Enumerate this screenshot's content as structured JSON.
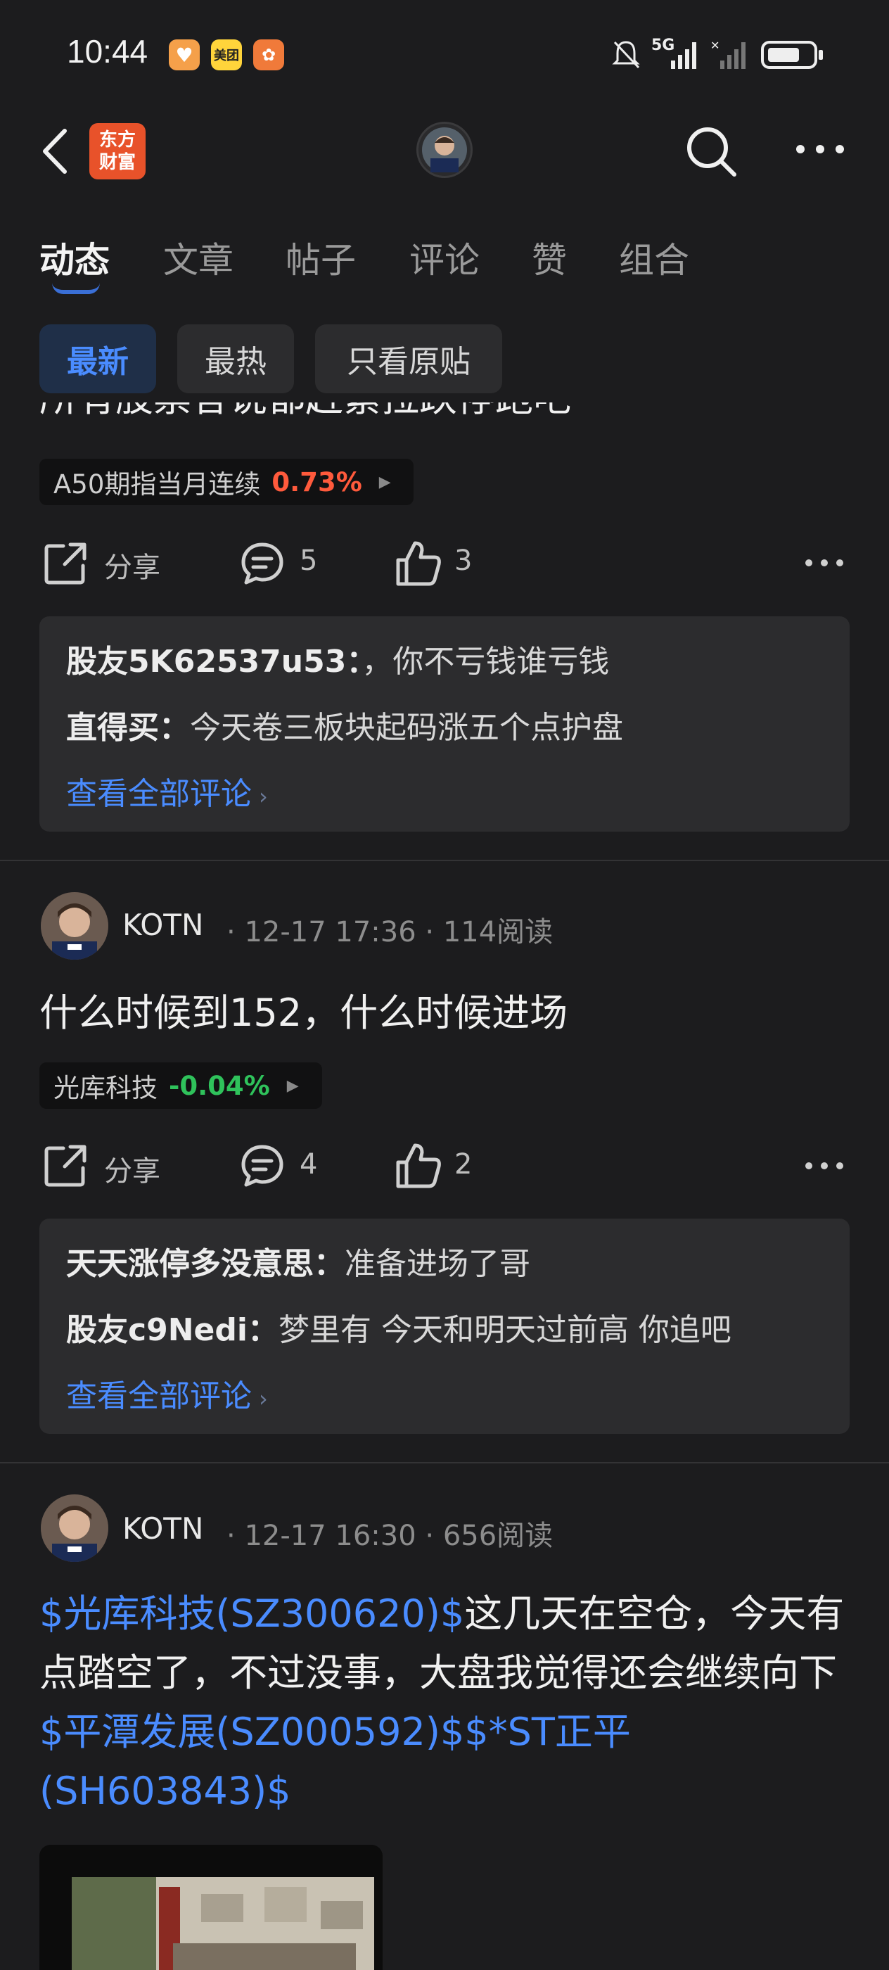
{
  "status_bar": {
    "time": "10:44",
    "apps": [
      "美团"
    ],
    "network": "5G"
  },
  "header": {
    "logo_text_line1": "东方",
    "logo_text_line2": "财富"
  },
  "tabs": [
    {
      "label": "动态",
      "active": true
    },
    {
      "label": "文章"
    },
    {
      "label": "帖子"
    },
    {
      "label": "评论"
    },
    {
      "label": "赞"
    },
    {
      "label": "组合"
    }
  ],
  "filters": [
    {
      "label": "最新",
      "active": true
    },
    {
      "label": "最热"
    },
    {
      "label": "只看原贴"
    }
  ],
  "posts": [
    {
      "text": "所有股票答说都赶紧拉跌停跑吧",
      "stock_chip": {
        "name": "A50期指当月连续",
        "change": "0.73%"
      },
      "actions": {
        "share": "分享",
        "comments": "5",
        "likes": "3"
      },
      "comments": [
        {
          "user": "股友5K62537u53",
          "text": "，你不亏钱谁亏钱"
        },
        {
          "user": "直得买",
          "text": "今天卷三板块起码涨五个点护盘"
        }
      ],
      "see_all": "查看全部评论"
    },
    {
      "user": "KOTN",
      "time": "12-17 17:36",
      "reads": "114阅读",
      "text": "什么时候到152，什么时候进场",
      "stock_chip": {
        "name": "光库科技",
        "change": "-0.04%"
      },
      "actions": {
        "share": "分享",
        "comments": "4",
        "likes": "2"
      },
      "comments": [
        {
          "user": "天天涨停多没意思",
          "text": "准备进场了哥"
        },
        {
          "user": "股友c9Nedi",
          "text": "梦里有 今天和明天过前高 你追吧"
        }
      ],
      "see_all": "查看全部评论"
    },
    {
      "user": "KOTN",
      "time": "12-17 16:30",
      "reads": "656阅读",
      "text_parts": [
        {
          "t": "$光库科技(SZ300620)$",
          "link": true
        },
        {
          "t": "这几天在空仓，今天有点踏空了，不过没事，大盘我觉得还会继续向下",
          "link": false
        },
        {
          "t": "$平潭发展(SZ000592)$$*ST正平(SH603843)$",
          "link": true
        }
      ]
    }
  ],
  "colors": {
    "accent": "#4a8cff",
    "up": "#ff5a3c",
    "down": "#2fc25b",
    "bg": "#1c1c1e"
  }
}
